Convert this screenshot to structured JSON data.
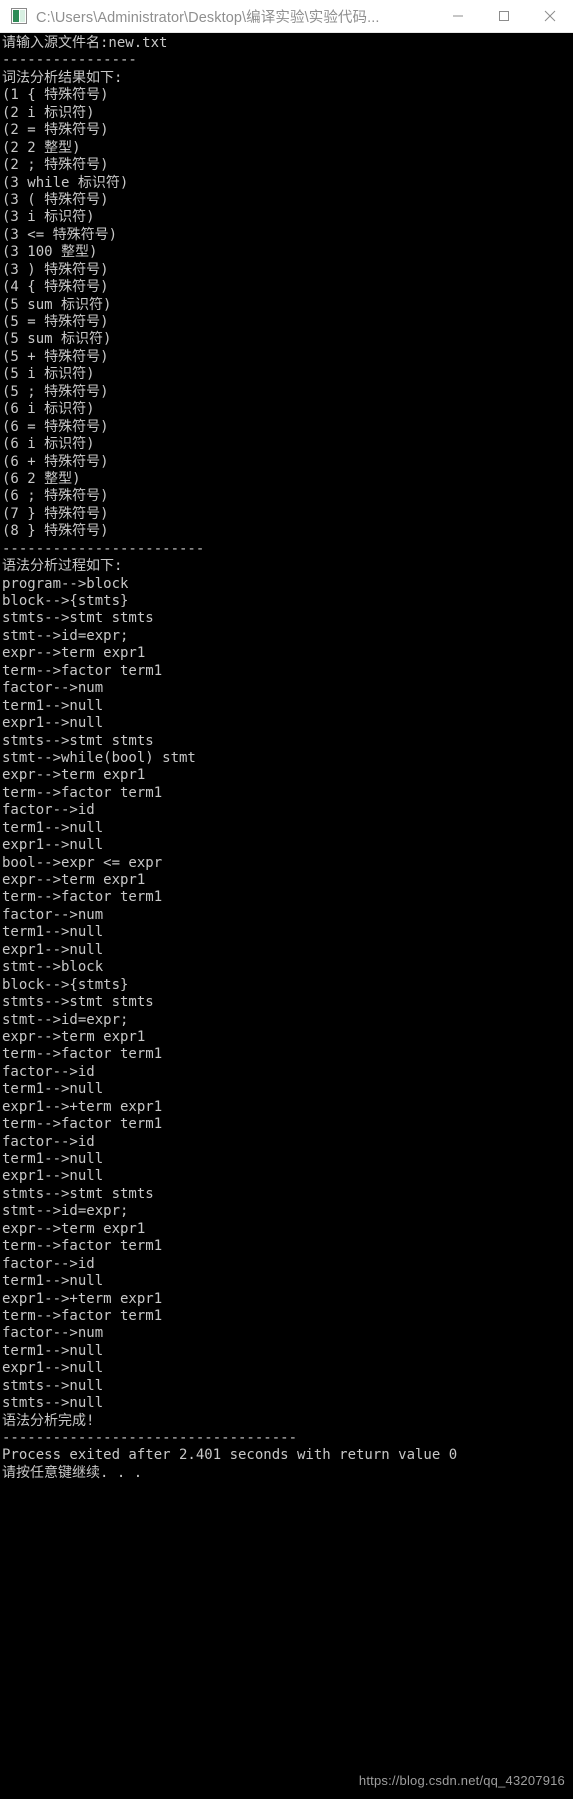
{
  "window": {
    "title": "C:\\Users\\Administrator\\Desktop\\编译实验\\实验代码...",
    "icon": "app-icon",
    "minimize_label": "—",
    "maximize_label": "□",
    "close_label": "✕",
    "background": "#000000",
    "foreground": "#c8c8c8",
    "titlebar_background": "#ffffff",
    "titlebar_foreground": "#8f8f8f"
  },
  "console": {
    "lines": [
      "请输入源文件名:new.txt",
      "----------------",
      "词法分析结果如下:",
      "(1 { 特殊符号)",
      "(2 i 标识符)",
      "(2 = 特殊符号)",
      "(2 2 整型)",
      "(2 ; 特殊符号)",
      "(3 while 标识符)",
      "(3 ( 特殊符号)",
      "(3 i 标识符)",
      "(3 <= 特殊符号)",
      "(3 100 整型)",
      "(3 ) 特殊符号)",
      "(4 { 特殊符号)",
      "(5 sum 标识符)",
      "(5 = 特殊符号)",
      "(5 sum 标识符)",
      "(5 + 特殊符号)",
      "(5 i 标识符)",
      "(5 ; 特殊符号)",
      "(6 i 标识符)",
      "(6 = 特殊符号)",
      "(6 i 标识符)",
      "(6 + 特殊符号)",
      "(6 2 整型)",
      "(6 ; 特殊符号)",
      "(7 } 特殊符号)",
      "(8 } 特殊符号)",
      "------------------------",
      "语法分析过程如下:",
      "program-->block",
      "block-->{stmts}",
      "stmts-->stmt stmts",
      "stmt-->id=expr;",
      "expr-->term expr1",
      "term-->factor term1",
      "factor-->num",
      "term1-->null",
      "expr1-->null",
      "stmts-->stmt stmts",
      "stmt-->while(bool) stmt",
      "expr-->term expr1",
      "term-->factor term1",
      "factor-->id",
      "term1-->null",
      "expr1-->null",
      "bool-->expr <= expr",
      "expr-->term expr1",
      "term-->factor term1",
      "factor-->num",
      "term1-->null",
      "expr1-->null",
      "stmt-->block",
      "block-->{stmts}",
      "stmts-->stmt stmts",
      "stmt-->id=expr;",
      "expr-->term expr1",
      "term-->factor term1",
      "factor-->id",
      "term1-->null",
      "expr1-->+term expr1",
      "term-->factor term1",
      "factor-->id",
      "term1-->null",
      "expr1-->null",
      "stmts-->stmt stmts",
      "stmt-->id=expr;",
      "expr-->term expr1",
      "term-->factor term1",
      "factor-->id",
      "term1-->null",
      "expr1-->+term expr1",
      "term-->factor term1",
      "factor-->num",
      "term1-->null",
      "expr1-->null",
      "stmts-->null",
      "stmts-->null",
      "语法分析完成!",
      "-----------------------------------",
      "Process exited after 2.401 seconds with return value 0",
      "请按任意键继续. . ."
    ]
  },
  "watermark": {
    "text": "https://blog.csdn.net/qq_43207916"
  }
}
